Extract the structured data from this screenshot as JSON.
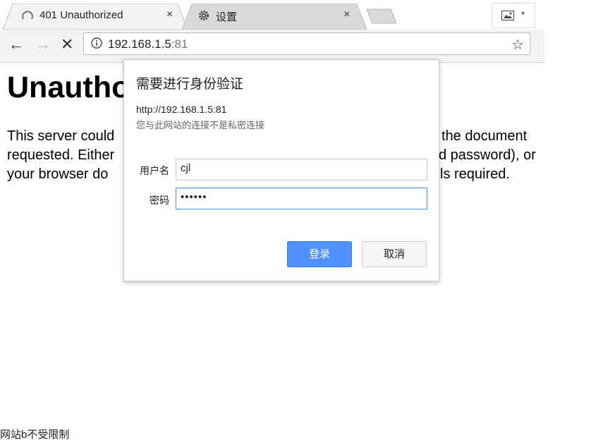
{
  "tabs": [
    {
      "title": "401 Unauthorized",
      "close": "×",
      "icon": "loading-spinner-icon"
    },
    {
      "title": "设置",
      "close": "×",
      "icon": "gear-icon"
    }
  ],
  "toolbar": {
    "back": "←",
    "forward": "→",
    "stop": "✕",
    "url_host": "192.168.1.5",
    "url_port": ":81",
    "star": "☆"
  },
  "page": {
    "heading_visible": "Unautho",
    "body_lines": [
      "This server could",
      "requested. Either",
      "your browser do"
    ],
    "body_right_lines": [
      "the document",
      "d password), or",
      "ls required."
    ]
  },
  "dialog": {
    "title": "需要进行身份验证",
    "host": "http://192.168.1.5:81",
    "note": "您与此网站的连接不是私密连接",
    "username_label": "用户名",
    "username_value": "cjl",
    "password_label": "密码",
    "password_value": "••••••",
    "login_button": "登录",
    "cancel_button": "取消"
  },
  "status_bar": "网站b不受限制",
  "colors": {
    "accent": "#4d90fe",
    "chrome_bg": "#f2f2f2"
  }
}
